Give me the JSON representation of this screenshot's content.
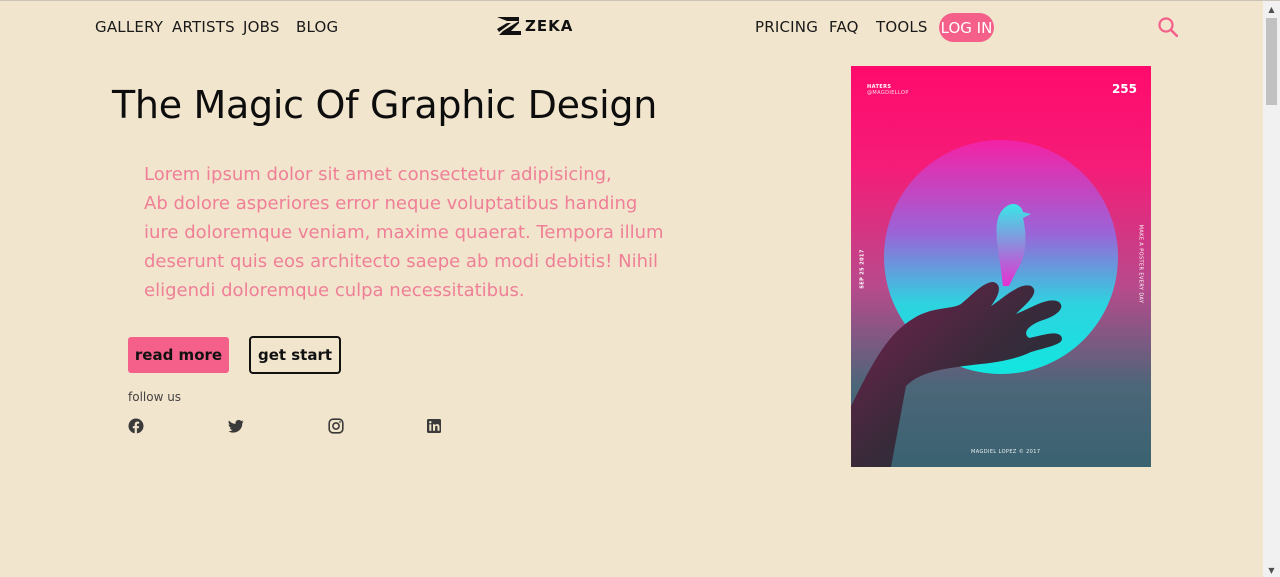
{
  "nav": {
    "left": [
      "GALLERY",
      "ARTISTS",
      "JOBS",
      "BLOG"
    ],
    "right": [
      "PRICING",
      "FAQ",
      "TOOLS"
    ],
    "login": "LOG IN",
    "logo_text": "ZEKA"
  },
  "hero": {
    "title": "The Magic Of Graphic Design",
    "paragraph_lines": [
      "Lorem ipsum dolor sit amet consectetur adipisicing,",
      "Ab dolore asperiores error neque voluptatibus handing",
      "iure doloremque veniam, maxime quaerat. Tempora illum",
      "deserunt quis eos architecto saepe ab modi debitis! Nihil",
      "eligendi doloremque culpa necessitatibus."
    ],
    "read_more": "read more",
    "get_start": "get start",
    "follow_us": "follow us"
  },
  "social": [
    "facebook-icon",
    "twitter-icon",
    "instagram-icon",
    "linkedin-icon"
  ],
  "poster": {
    "top_label": "HATERS",
    "top_sublabel": "@MAGDIELLOP",
    "number": "255",
    "left_side": "SEP 25 2017",
    "right_side": "MAKE A POSTER EVERY DAY",
    "footer": "MAGDIEL LOPEZ © 2017"
  },
  "colors": {
    "background": "#f2e5cd",
    "accent": "#f4608a",
    "paragraph": "#ef7f97"
  }
}
